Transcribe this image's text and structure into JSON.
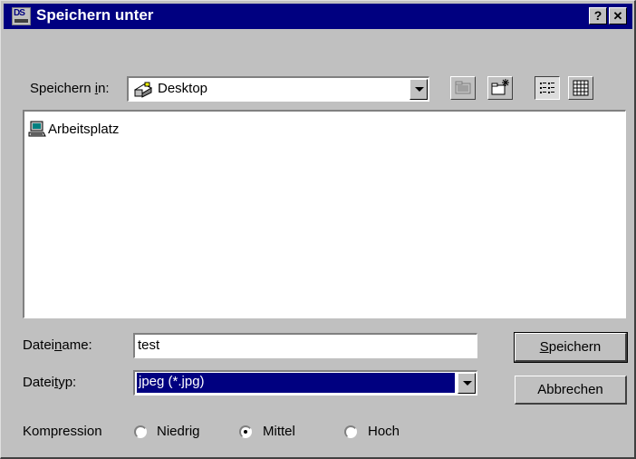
{
  "window": {
    "title": "Speichern unter",
    "help_button": "?",
    "close_button": "✕"
  },
  "save_in": {
    "label_pre": "Speichern ",
    "label_accel": "i",
    "label_post": "n:",
    "value": "Desktop"
  },
  "files": [
    {
      "name": "Arbeitsplatz"
    }
  ],
  "filename": {
    "label_pre": "Datei",
    "label_accel": "n",
    "label_post": "ame:",
    "value": "test"
  },
  "filetype": {
    "label_pre": "Datei",
    "label_accel": "t",
    "label_post": "yp:",
    "value": "jpeg (*.jpg)"
  },
  "buttons": {
    "save_accel": "S",
    "save_rest": "peichern",
    "cancel": "Abbrechen"
  },
  "compression": {
    "label": "Kompression",
    "options": [
      "Niedrig",
      "Mittel",
      "Hoch"
    ],
    "selected": "Mittel"
  },
  "colors": {
    "titlebar": "#000080",
    "face": "#c0c0c0",
    "selection": "#000080"
  }
}
